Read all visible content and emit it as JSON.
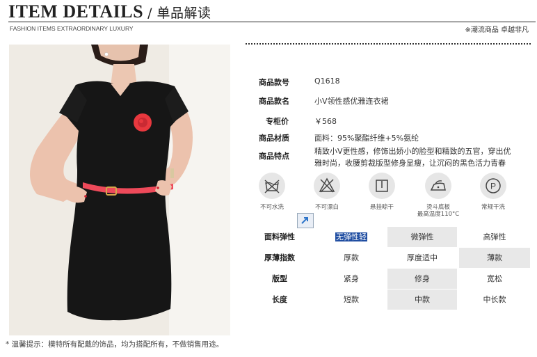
{
  "header": {
    "title": "ITEM DETAILS",
    "subtitle": "/ 单品解读",
    "tagline": "FASHION ITEMS EXTRAORDINARY LUXURY",
    "slogan": "※潮流商品 卓越非凡"
  },
  "specs": [
    {
      "key": "商品款号",
      "value": "Q1618"
    },
    {
      "key": "商品款名",
      "value": "小V领性感优雅连衣裙"
    },
    {
      "key": "专柜价",
      "value": "￥568"
    },
    {
      "key": "商品材质",
      "value": "面料：95%聚酯纤维+5%氨纶"
    },
    {
      "key": "商品特点",
      "value_line1": "精致小V更性感，修饰出娇小的脸型和精致的五官，穿出优",
      "value_line2": "雅时尚，收腰剪裁版型修身显瘦，让沉闷的黑色活力青春"
    }
  ],
  "care": [
    {
      "icon": "no-hand-wash-icon",
      "label": "不可水洗"
    },
    {
      "icon": "no-bleach-icon",
      "label": "不可漂白"
    },
    {
      "icon": "hang-dry-icon",
      "label": "悬挂晾干"
    },
    {
      "icon": "iron-icon",
      "label": "烫斗底板",
      "label2": "最高温度110°C"
    },
    {
      "icon": "dry-clean-icon",
      "label": "常规干洗"
    }
  ],
  "attributes": [
    {
      "name": "面料弹性",
      "options": [
        "无弹性轻",
        "微弹性",
        "高弹性"
      ],
      "selected": 0
    },
    {
      "name": "厚薄指数",
      "options": [
        "厚款",
        "厚度适中",
        "薄款"
      ],
      "selected": 2
    },
    {
      "name": "版型",
      "options": [
        "紧身",
        "修身",
        "宽松"
      ],
      "selected": 1
    },
    {
      "name": "长度",
      "options": [
        "短款",
        "中款",
        "中长款"
      ],
      "selected": 1
    }
  ],
  "note": "* 温馨提示：模特所有配戴的饰品，均为搭配所有，不做销售用途。",
  "colors": {
    "dress": "#161616",
    "flower": "#e8383e",
    "belt": "#ee4a5a",
    "selected_bg": "#1f4da1"
  }
}
